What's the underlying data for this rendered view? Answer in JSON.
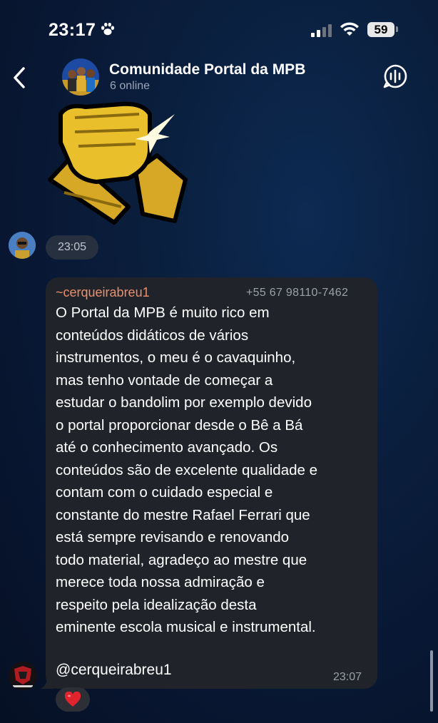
{
  "status_bar": {
    "time": "23:17",
    "battery": "59",
    "icons": [
      "paw-icon",
      "signal-icon",
      "wifi-icon",
      "battery-icon"
    ]
  },
  "header": {
    "title": "Comunidade Portal da MPB",
    "subtitle": "6 online",
    "icons": [
      "back-chevron-icon",
      "voice-chat-icon"
    ]
  },
  "messages": [
    {
      "type": "sticker",
      "description_icon": "handshake-sticker-icon",
      "time": "23:05"
    },
    {
      "type": "text",
      "author": "~cerqueirabreu1",
      "phone": "+55 67 98110-7462",
      "lines": [
        "O Portal da MPB é muito rico em",
        "conteúdos didáticos de vários",
        "instrumentos, o meu é o cavaquinho,",
        "mas tenho vontade de começar a",
        "estudar o bandolim por exemplo devido",
        "o portal proporcionar desde o Bê a Bá",
        "até o conhecimento avançado. Os",
        "conteúdos são de excelente qualidade e",
        "contam com o cuidado especial e",
        "constante do mestre Rafael Ferrari que",
        "está sempre revisando e renovando",
        "todo material, agradeço ao mestre que",
        "merece toda nossa admiração e",
        "respeito pela idealização desta",
        "eminente escola musical e instrumental."
      ],
      "mention": "@cerqueirabreu1",
      "time": "23:07",
      "reaction": "heart-icon"
    }
  ],
  "colors": {
    "background": "#081631",
    "bubble": "#20232a",
    "author": "#ee8e6a",
    "secondary_text": "#9aa0aa"
  }
}
